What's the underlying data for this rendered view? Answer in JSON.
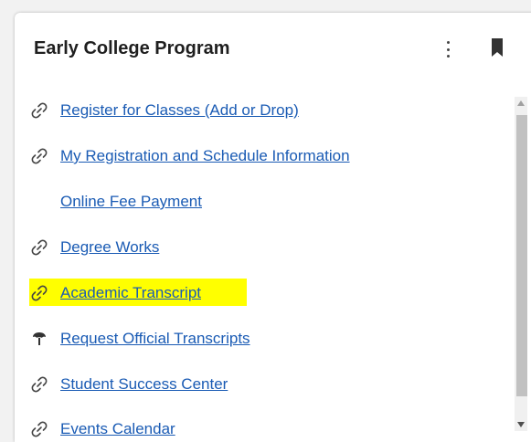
{
  "card": {
    "title": "Early College Program",
    "menu_icon": "vertical-dots-icon",
    "bookmark_icon": "bookmark-icon"
  },
  "links": [
    {
      "label": "Register for Classes (Add or Drop)",
      "icon": "link-icon"
    },
    {
      "label": "My Registration and Schedule Information",
      "icon": "link-icon"
    },
    {
      "label": "Online Fee Payment",
      "icon": ""
    },
    {
      "label": "Degree Works",
      "icon": "link-icon"
    },
    {
      "label": "Academic Transcript",
      "icon": "link-icon",
      "highlighted": true,
      "highlight_color": "#ffff00"
    },
    {
      "label": "Request Official Transcripts",
      "icon": "tree-icon"
    },
    {
      "label": "Student Success Center",
      "icon": "link-icon"
    },
    {
      "label": "Events Calendar",
      "icon": "link-icon"
    }
  ],
  "colors": {
    "link": "#1a5bb4",
    "title": "#1f1f1f",
    "highlight": "#ffff00"
  }
}
